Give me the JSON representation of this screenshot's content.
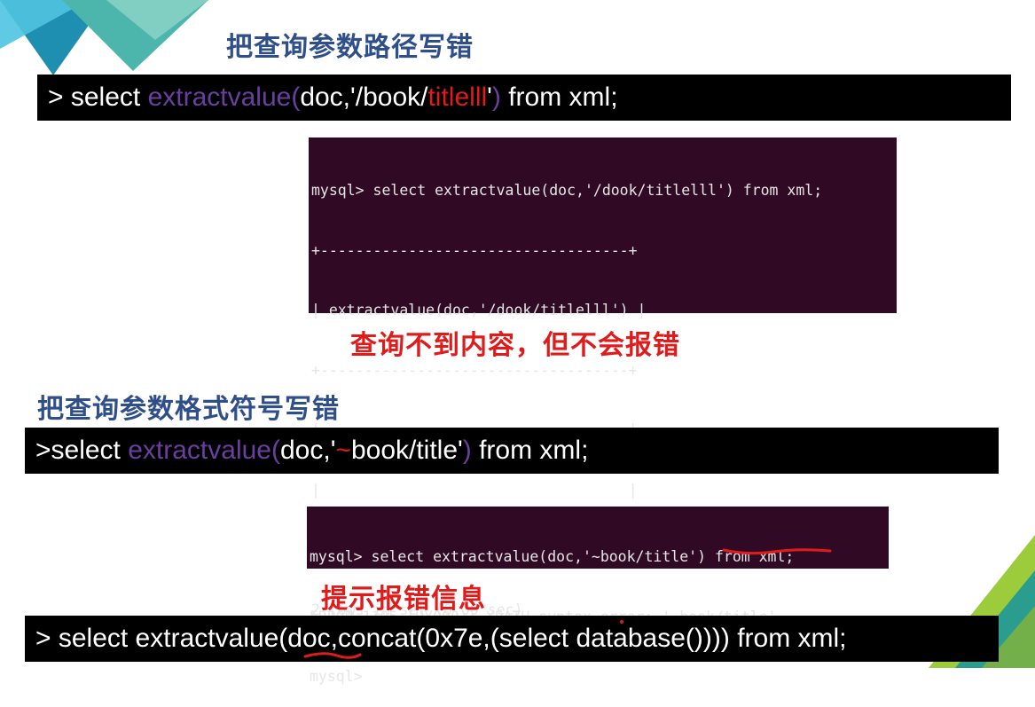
{
  "slide": {
    "colors": {
      "accent_blue": "#2f4f8a",
      "error_red": "#e01b1b",
      "function_purple": "#6a3fa0",
      "terminal_bg": "#300a24",
      "teal_decor": "#4db6ac",
      "green_decor": "#9ccc3c"
    }
  },
  "section1": {
    "heading": "把查询参数路径写错",
    "command": {
      "prefix": "> select ",
      "fn": "extractvalue",
      "paren_open": "(",
      "arg1": "doc,'/book/",
      "arg_err": "titlelll",
      "arg_end": "'",
      "paren_close": ")",
      "suffix": " from xml;"
    },
    "terminal": {
      "line1": "mysql> select extractvalue(doc,'/dook/titlelll') from xml;",
      "line2": "+-----------------------------------+",
      "line3": "| extractvalue(doc,'/dook/titlelll') |",
      "line4": "+-----------------------------------+",
      "line5": "|                                   |",
      "line6": "|                                   |",
      "line7": "+-----------------------------------+",
      "line8": "2 rows in set (0.00 sec)"
    },
    "note": "查询不到内容，但不会报错"
  },
  "section2": {
    "heading": "把查询参数格式符号写错",
    "command": {
      "prefix": ">select ",
      "fn": "extractvalue",
      "paren_open": "(",
      "arg1": "doc,'",
      "arg_err": "~",
      "arg_end": "book/title'",
      "paren_close": ")",
      "suffix": " from xml;"
    },
    "terminal": {
      "line1": "mysql> select extractvalue(doc,'~book/title') from xml;",
      "line2": "ERROR 1105 (HY000): XPATH syntax error: '~book/title'",
      "line3": "mysql>"
    },
    "note": "提示报错信息"
  },
  "section3": {
    "command": "> select extractvalue(doc,concat(0x7e,(select database()))) from xml;"
  }
}
